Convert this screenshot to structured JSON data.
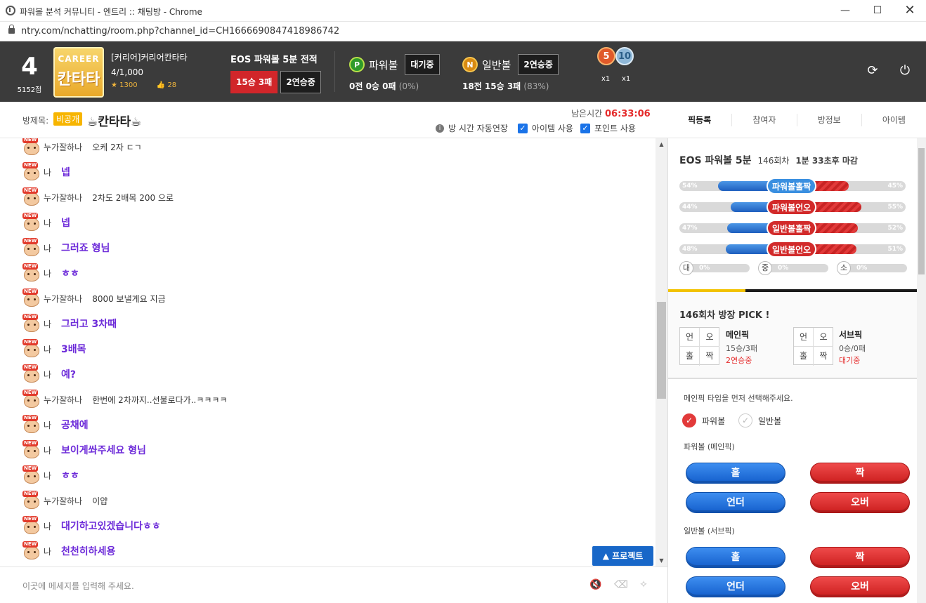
{
  "window": {
    "title": "파워볼 분석 커뮤니티 - 엔트리 :: 채팅방 - Chrome",
    "url": "ntry.com/nchatting/room.php?channel_id=CH1666690847418986742"
  },
  "header": {
    "level": "4",
    "points": "5152점",
    "badge_top": "CAREER",
    "badge_name": "칸타타",
    "nickname": "[커리어]커리어칸타타",
    "rank": "4/1,000",
    "stars": "1300",
    "likes": "28",
    "record_label": "EOS 파워볼 5분 전적",
    "record_tag": "15승 3패",
    "record_streak": "2연승중",
    "powerball": {
      "icon": "P",
      "name": "파워볼",
      "status": "대기중",
      "stats": "0전 0승 0패",
      "pct": "(0%)"
    },
    "normalball": {
      "icon": "N",
      "name": "일반볼",
      "status": "2연승중",
      "stats": "18전 15승 3패",
      "pct": "(83%)"
    },
    "medals": [
      {
        "num": "5",
        "count": "x1"
      },
      {
        "num": "10",
        "count": "x1"
      }
    ]
  },
  "room": {
    "label": "방제목:",
    "badge": "비공개",
    "name": "☕칸타타☕",
    "remain_label": "남은시간",
    "remain_time": "06:33:06",
    "auto_extend": "방 시간 자동연장",
    "item_use": "아이템 사용",
    "point_use": "포인트 사용"
  },
  "right_tabs": [
    "픽등록",
    "참여자",
    "방정보",
    "아이템"
  ],
  "chat": [
    {
      "who": "누가잘하나",
      "text": "오케 2자 ㄷㄱ",
      "me": false
    },
    {
      "who": "나",
      "text": "넵",
      "me": true
    },
    {
      "who": "누가잘하나",
      "text": "2차도 2배목 200 으로",
      "me": false
    },
    {
      "who": "나",
      "text": "넵",
      "me": true
    },
    {
      "who": "나",
      "text": "그러죠 형님",
      "me": true
    },
    {
      "who": "나",
      "text": "ㅎㅎ",
      "me": true
    },
    {
      "who": "누가잘하나",
      "text": "8000 보낼게요 지금",
      "me": false
    },
    {
      "who": "나",
      "text": "그러고 3차때",
      "me": true
    },
    {
      "who": "나",
      "text": "3배목",
      "me": true
    },
    {
      "who": "나",
      "text": "예?",
      "me": true
    },
    {
      "who": "누가잘하나",
      "text": "한번에 2차까지..선불로다가..ㅋㅋㅋㅋ",
      "me": false
    },
    {
      "who": "나",
      "text": "공채에",
      "me": true
    },
    {
      "who": "나",
      "text": "보이게쏴주세요 형님",
      "me": true
    },
    {
      "who": "나",
      "text": "ㅎㅎ",
      "me": true
    },
    {
      "who": "누가잘하나",
      "text": "이얍",
      "me": false
    },
    {
      "who": "나",
      "text": "대기하고있겠습니다ㅎㅎ",
      "me": true
    },
    {
      "who": "나",
      "text": "천천히하세용",
      "me": true
    }
  ],
  "protect_label": "▲ 프로젝트",
  "input_placeholder": "이곳에 메세지를 입력해 주세요.",
  "panel": {
    "title": "EOS 파워볼 5분",
    "round": "146회차",
    "countdown": "1분 33초후 마감",
    "countdown_suffix": "후 마감",
    "bars": [
      {
        "label": "파워볼홀짝",
        "left": "54%",
        "right": "45%",
        "left_frac": 0.54,
        "pill": "b"
      },
      {
        "label": "파워볼언오",
        "left": "44%",
        "right": "55%",
        "left_frac": 0.44,
        "pill": "r"
      },
      {
        "label": "일반볼홀짝",
        "left": "47%",
        "right": "52%",
        "left_frac": 0.47,
        "pill": "r"
      },
      {
        "label": "일반볼언오",
        "left": "48%",
        "right": "51%",
        "left_frac": 0.48,
        "pill": "r"
      }
    ],
    "minis": [
      {
        "k": "대",
        "v": "0%"
      },
      {
        "k": "중",
        "v": "0%"
      },
      {
        "k": "소",
        "v": "0%"
      }
    ],
    "round_progress": 0.31,
    "pick_title": "146회차 방장 PICK !",
    "main_pick": {
      "grid": [
        "언",
        "오",
        "홀",
        "짝"
      ],
      "name": "메인픽",
      "record": "15승/3패",
      "streak": "2연승중"
    },
    "sub_pick": {
      "grid": [
        "언",
        "오",
        "홀",
        "짝"
      ],
      "name": "서브픽",
      "record": "0승/0패",
      "streak": "대기중"
    },
    "guide": "메인픽 타입을 먼저 선택해주세요.",
    "radio_power": "파워볼",
    "radio_normal": "일반볼",
    "grp_power": "파워볼 (메인픽)",
    "grp_normal": "일반볼 (서브픽)",
    "btn_odd": "홀",
    "btn_even": "짝",
    "btn_under": "언더",
    "btn_over": "오버"
  }
}
